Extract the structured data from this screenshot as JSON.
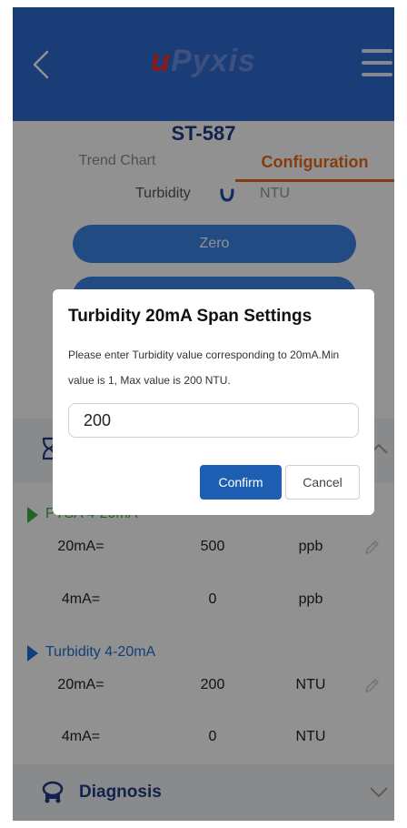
{
  "header": {
    "logo_prefix": "u",
    "logo_rest": "Pyxis",
    "back_icon": "chevron-left-icon",
    "menu_icon": "hamburger-menu-icon"
  },
  "device": {
    "name": "ST-587"
  },
  "tabs": [
    {
      "label": "Trend Chart",
      "active": false
    },
    {
      "label": "Configuration",
      "active": true
    }
  ],
  "parameter": {
    "label": "Turbidity",
    "unit": "NTU"
  },
  "actions": {
    "zero_label": "Zero"
  },
  "groups": [
    {
      "title": "PTSA 4-20mA",
      "rows": [
        {
          "label": "20mA=",
          "value": "500",
          "unit": "ppb"
        },
        {
          "label": "4mA=",
          "value": "0",
          "unit": "ppb"
        }
      ]
    },
    {
      "title": "Turbidity 4-20mA",
      "rows": [
        {
          "label": "20mA=",
          "value": "200",
          "unit": "NTU"
        },
        {
          "label": "4mA=",
          "value": "0",
          "unit": "NTU"
        }
      ]
    }
  ],
  "diagnosis": {
    "label": "Diagnosis"
  },
  "dialog": {
    "title": "Turbidity 20mA Span Settings",
    "message": "Please enter Turbidity value corresponding to 20mA.Min value is 1, Max value is 200 NTU.",
    "input_value": "200",
    "confirm_label": "Confirm",
    "cancel_label": "Cancel"
  },
  "colors": {
    "header_bg": "#2f6ad1",
    "accent_orange": "#ea6a19",
    "pill_blue": "#3d82e6",
    "green_group": "#3cb043",
    "blue_group": "#1f6fd6",
    "confirm_bg": "#1f5fb3",
    "logo_red": "#ff2a22"
  }
}
